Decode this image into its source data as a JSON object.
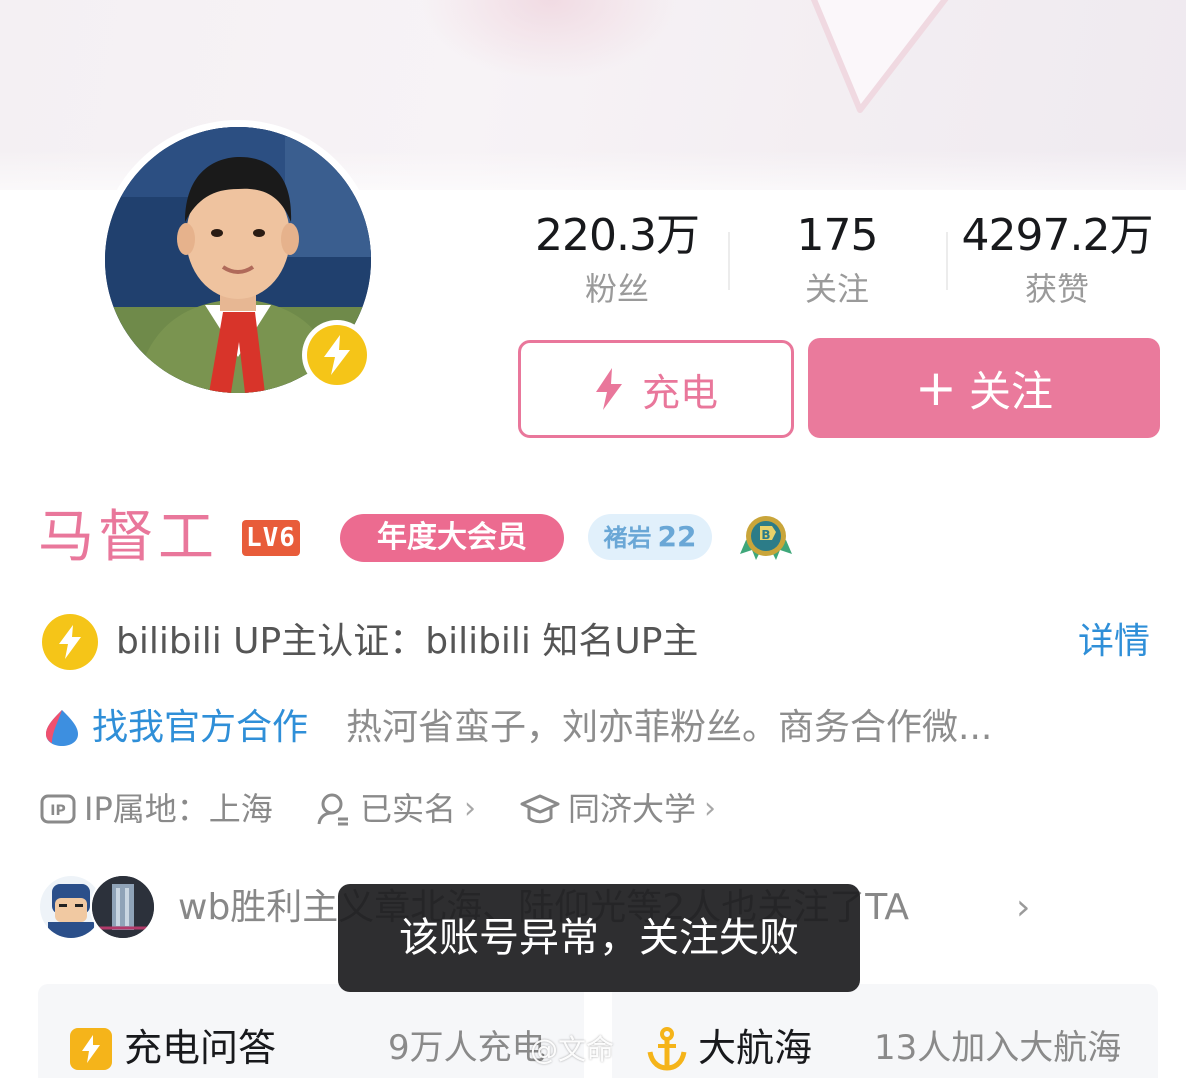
{
  "profile": {
    "name": "马督工",
    "level": "LV6",
    "vip_label": "年度大会员",
    "medal": {
      "name": "褚岩",
      "level": "22"
    }
  },
  "stats": [
    {
      "value": "220.3万",
      "label": "粉丝"
    },
    {
      "value": "175",
      "label": "关注"
    },
    {
      "value": "4297.2万",
      "label": "获赞"
    }
  ],
  "actions": {
    "charge_label": "充电",
    "follow_label": "关注",
    "follow_prefix": "+"
  },
  "auth": {
    "text": "bilibili UP主认证：bilibili 知名UP主",
    "detail_label": "详情"
  },
  "bio": {
    "coop_link": "找我官方合作",
    "text": "热河省蛮子，刘亦菲粉丝。商务合作微..."
  },
  "info": {
    "ip": "IP属地：上海",
    "realname": "已实名",
    "school": "同济大学"
  },
  "mutual": {
    "text": "wb胜利主义章北海、陆仰光等2人也关注了TA"
  },
  "toast": "该账号异常，关注失败",
  "cards": {
    "qa_title": "充电问答",
    "qa_sub": "9万人充电",
    "fleet_title": "大航海",
    "fleet_sub": "13人加入大航海"
  },
  "watermark": "@文命",
  "colors": {
    "brand_pink": "#ea7a9c",
    "link_blue": "#2f8fd8",
    "up_yellow": "#f5c518",
    "level_red": "#e85c3a"
  }
}
